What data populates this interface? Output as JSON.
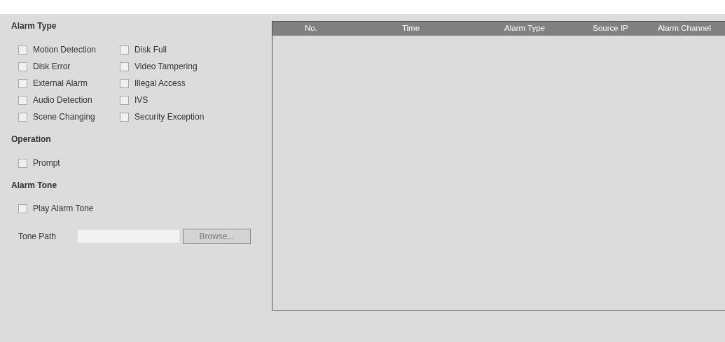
{
  "alarm_type": {
    "title": "Alarm Type",
    "options": [
      {
        "label": "Motion Detection",
        "checked": false
      },
      {
        "label": "Disk Full",
        "checked": false
      },
      {
        "label": "Disk Error",
        "checked": false
      },
      {
        "label": "Video Tampering",
        "checked": false
      },
      {
        "label": "External Alarm",
        "checked": false
      },
      {
        "label": "Illegal Access",
        "checked": false
      },
      {
        "label": "Audio Detection",
        "checked": false
      },
      {
        "label": "IVS",
        "checked": false
      },
      {
        "label": "Scene Changing",
        "checked": false
      },
      {
        "label": "Security Exception",
        "checked": false
      }
    ]
  },
  "operation": {
    "title": "Operation",
    "options": [
      {
        "label": "Prompt",
        "checked": false
      }
    ]
  },
  "alarm_tone": {
    "title": "Alarm Tone",
    "options": [
      {
        "label": "Play Alarm Tone",
        "checked": false
      }
    ],
    "tone_path": {
      "label": "Tone Path"
    },
    "browse_button": {
      "label": "Browse...",
      "disabled": true
    }
  },
  "table": {
    "columns": [
      "No.",
      "Time",
      "Alarm Type",
      "Source IP",
      "Alarm Channel"
    ]
  }
}
